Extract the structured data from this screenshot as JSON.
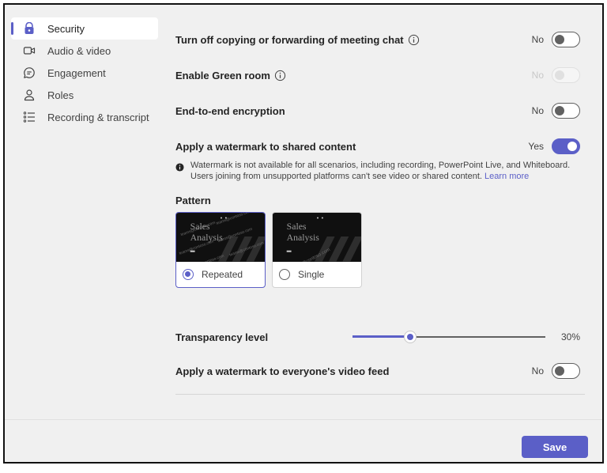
{
  "sidebar": {
    "items": [
      {
        "label": "Security",
        "icon": "shield-icon",
        "active": true
      },
      {
        "label": "Audio & video",
        "icon": "video-camera-icon",
        "active": false
      },
      {
        "label": "Engagement",
        "icon": "chat-bubble-icon",
        "active": false
      },
      {
        "label": "Roles",
        "icon": "person-icon",
        "active": false
      },
      {
        "label": "Recording & transcript",
        "icon": "list-icon",
        "active": false
      }
    ]
  },
  "settings": {
    "copy_chat": {
      "label": "Turn off copying or forwarding of meeting chat",
      "state": "No",
      "on": false,
      "has_info": true
    },
    "green_room": {
      "label": "Enable Green room",
      "state": "No",
      "on": false,
      "disabled": true,
      "has_info": true
    },
    "e2e": {
      "label": "End-to-end encryption",
      "state": "No",
      "on": false
    },
    "watermark_shared": {
      "label": "Apply a watermark to shared content",
      "state": "Yes",
      "on": true
    },
    "watermark_video": {
      "label": "Apply a watermark to everyone's video feed",
      "state": "No",
      "on": false
    }
  },
  "notice": {
    "text": "Watermark is not available for all scenarios, including recording, PowerPoint Live, and Whiteboard. Users joining from unsupported platforms can't see video or shared content.",
    "link": "Learn more"
  },
  "pattern": {
    "label": "Pattern",
    "options": [
      {
        "label": "Repeated",
        "selected": true,
        "thumb_title_1": "Sales",
        "thumb_title_2": "Analysis"
      },
      {
        "label": "Single",
        "selected": false,
        "thumb_title_1": "Sales",
        "thumb_title_2": "Analysis"
      }
    ]
  },
  "transparency": {
    "label": "Transparency level",
    "value": 30,
    "value_text": "30%"
  },
  "footer": {
    "save_label": "Save"
  },
  "colors": {
    "accent": "#5b5fc7",
    "background": "#f0f0f0"
  }
}
